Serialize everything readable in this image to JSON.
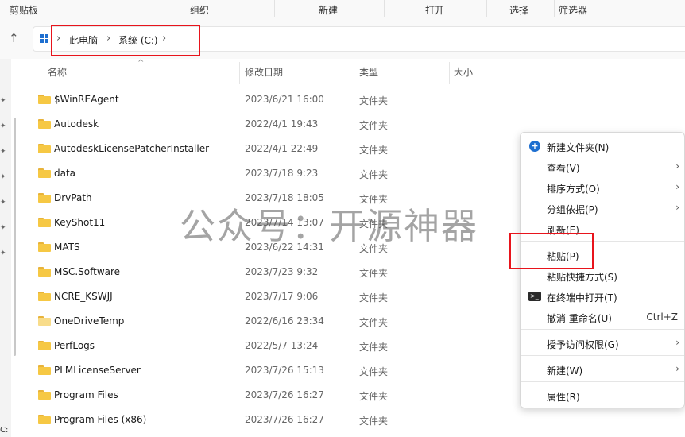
{
  "ribbon": {
    "labels": [
      "剪贴板",
      "组织",
      "新建",
      "打开",
      "选择",
      "筛选器"
    ]
  },
  "addressbar": {
    "root_icon": "this-pc-icon",
    "breadcrumbs": [
      "此电脑",
      "系统 (C:)"
    ]
  },
  "columns": [
    "名称",
    "修改日期",
    "类型",
    "大小"
  ],
  "files": [
    {
      "name": "$WinREAgent",
      "date": "2023/6/21 16:00",
      "type": "文件夹"
    },
    {
      "name": "Autodesk",
      "date": "2022/4/1 19:43",
      "type": "文件夹"
    },
    {
      "name": "AutodeskLicensePatcherInstaller",
      "date": "2022/4/1 22:49",
      "type": "文件夹"
    },
    {
      "name": "data",
      "date": "2023/7/18 9:23",
      "type": "文件夹"
    },
    {
      "name": "DrvPath",
      "date": "2023/7/18 18:05",
      "type": "文件夹"
    },
    {
      "name": "KeyShot11",
      "date": "2023/7/14 13:07",
      "type": "文件夹"
    },
    {
      "name": "MATS",
      "date": "2023/6/22 14:31",
      "type": "文件夹"
    },
    {
      "name": "MSC.Software",
      "date": "2023/7/23 9:32",
      "type": "文件夹"
    },
    {
      "name": "NCRE_KSWJJ",
      "date": "2023/7/17 9:06",
      "type": "文件夹"
    },
    {
      "name": "OneDriveTemp",
      "date": "2022/6/16 23:34",
      "type": "文件夹"
    },
    {
      "name": "PerfLogs",
      "date": "2022/5/7 13:24",
      "type": "文件夹"
    },
    {
      "name": "PLMLicenseServer",
      "date": "2023/7/26 15:13",
      "type": "文件夹"
    },
    {
      "name": "Program Files",
      "date": "2023/7/26 16:27",
      "type": "文件夹"
    },
    {
      "name": "Program Files (x86)",
      "date": "2023/7/26 16:27",
      "type": "文件夹"
    }
  ],
  "watermark": "公众号：开源神器",
  "context_menu": {
    "new_folder": "新建文件夹(N)",
    "view": "查看(V)",
    "sort": "排序方式(O)",
    "group": "分组依据(P)",
    "refresh": "刷新(E)",
    "paste": "粘贴(P)",
    "paste_shortcut": "粘贴快捷方式(S)",
    "open_terminal": "在终端中打开(T)",
    "undo_rename": "撤消 重命名(U)",
    "undo_shortcut": "Ctrl+Z",
    "give_access": "授予访问权限(G)",
    "new": "新建(W)",
    "properties": "属性(R)"
  },
  "drive_label_fragment": "C:",
  "colors": {
    "highlight_box": "#e8141c",
    "folder_yellow": "#f6c844",
    "accent_blue": "#1e6fd0"
  }
}
